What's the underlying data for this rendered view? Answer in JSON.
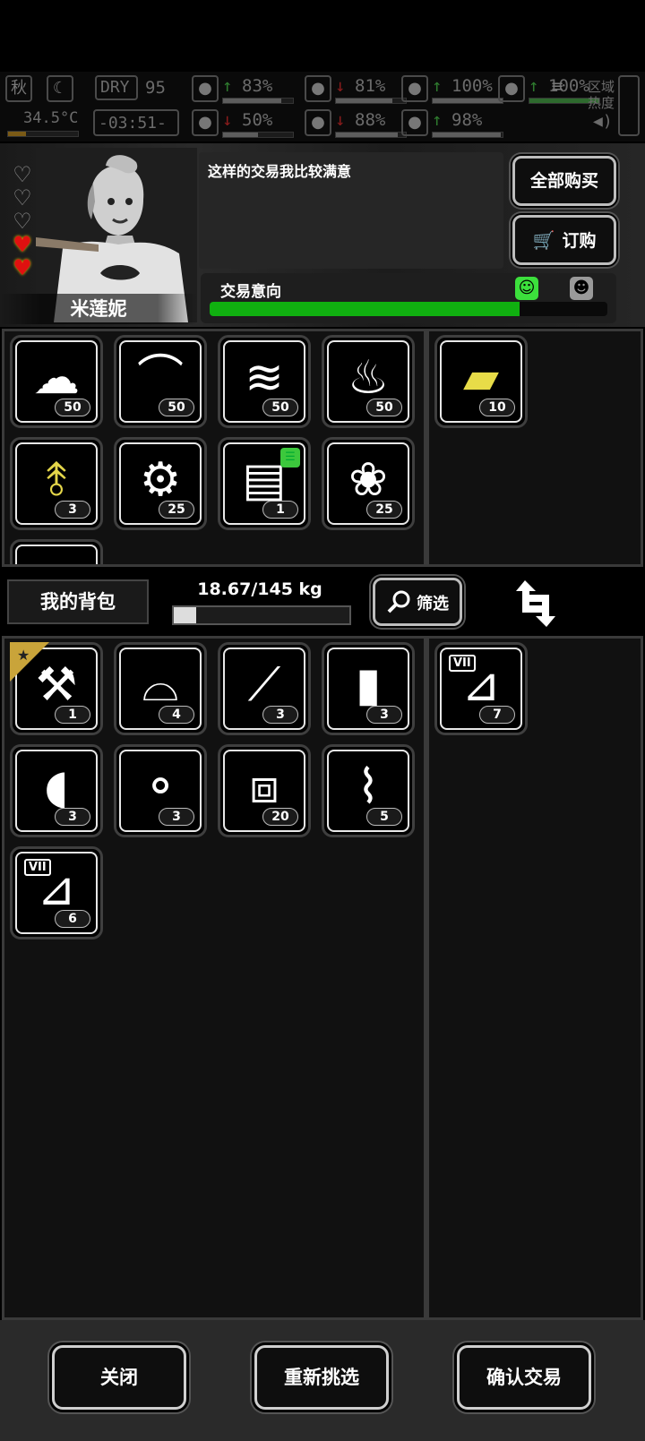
{
  "status": {
    "season": "秋",
    "weather": "DRY",
    "weather_value": "95",
    "temperature": "34.5°C",
    "time": "-03:51-",
    "stats": [
      {
        "name": "health",
        "icon": "medkit-icon",
        "trend": "up",
        "value": "83%",
        "level": 0.83
      },
      {
        "name": "sleep",
        "icon": "moon-icon",
        "trend": "down",
        "value": "81%",
        "level": 0.81
      },
      {
        "name": "armor",
        "icon": "capsule-icon",
        "trend": "up",
        "value": "100%",
        "level": 1.0
      },
      {
        "name": "brain",
        "icon": "brain-icon",
        "trend": "down",
        "value": "50%",
        "level": 0.5
      },
      {
        "name": "water",
        "icon": "drop-icon",
        "trend": "down",
        "value": "88%",
        "level": 0.88
      },
      {
        "name": "heart",
        "icon": "heart-icon",
        "trend": "up",
        "value": "98%",
        "level": 0.98
      },
      {
        "name": "flask",
        "icon": "flask-icon",
        "trend": "up",
        "value": "100%",
        "level": 1.0
      }
    ],
    "area_heat": "区域\n热度"
  },
  "merchant": {
    "name": "米莲妮",
    "hearts_full": 2,
    "hearts_total": 5,
    "dialog": "这样的交易我比较满意",
    "buy_all_label": "全部购买",
    "order_label": "订购",
    "intent_label": "交易意向",
    "intent_level": 0.78
  },
  "merchant_items": [
    {
      "icon": "cloth-icon",
      "glyph": "☁",
      "count": "50"
    },
    {
      "icon": "metal-scrap-icon",
      "glyph": "⌒",
      "count": "50"
    },
    {
      "icon": "pipes-icon",
      "glyph": "≋",
      "count": "50"
    },
    {
      "icon": "plastic-bottle-icon",
      "glyph": "♨",
      "count": "50"
    },
    {
      "icon": "wire-clips-icon",
      "glyph": "⥉",
      "count": "3",
      "color": "#e4d64a"
    },
    {
      "icon": "gears-icon",
      "glyph": "⚙",
      "count": "25"
    },
    {
      "icon": "circuit-board-icon",
      "glyph": "▤",
      "count": "1",
      "badge": true
    },
    {
      "icon": "cotton-icon",
      "glyph": "❀",
      "count": "25"
    }
  ],
  "merchant_offer": [
    {
      "icon": "gold-plate-icon",
      "glyph": "▰",
      "count": "10",
      "color": "#e8dc48"
    }
  ],
  "backpack": {
    "title": "我的背包",
    "weight": "18.67/145 kg",
    "weight_level": 0.1288,
    "filter_label": "筛选"
  },
  "backpack_items": [
    {
      "icon": "multitool-icon",
      "glyph": "⚒",
      "count": "1",
      "starred": true
    },
    {
      "icon": "bandage-roll-icon",
      "glyph": "⌓",
      "count": "4"
    },
    {
      "icon": "lockpick-icon",
      "glyph": "⟋",
      "count": "3"
    },
    {
      "icon": "water-bottle-icon",
      "glyph": "▮",
      "count": "3"
    },
    {
      "icon": "cloth-bandage-icon",
      "glyph": "◖",
      "count": "3"
    },
    {
      "icon": "skewer-icon",
      "glyph": "⚬",
      "count": "3"
    },
    {
      "icon": "ice-cubes-icon",
      "glyph": "⧈",
      "count": "20"
    },
    {
      "icon": "paper-roll-icon",
      "glyph": "⌇",
      "count": "5"
    },
    {
      "icon": "test-tube-icon",
      "glyph": "⊿",
      "count": "6",
      "tier": "VII"
    }
  ],
  "backpack_offer": [
    {
      "icon": "test-tube-icon",
      "glyph": "⊿",
      "count": "7",
      "tier": "VII"
    }
  ],
  "footer": {
    "close_label": "关闭",
    "reselect_label": "重新挑选",
    "confirm_label": "确认交易"
  }
}
